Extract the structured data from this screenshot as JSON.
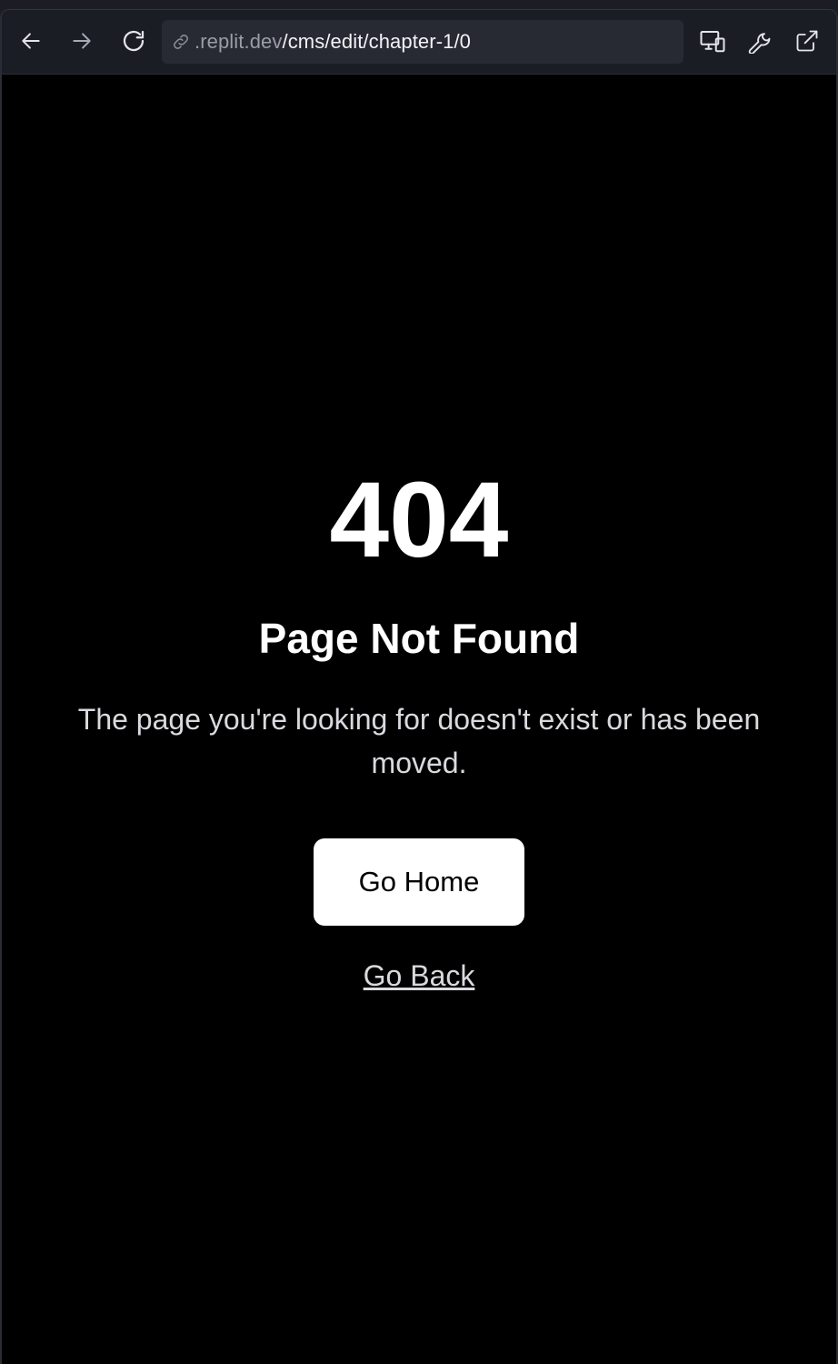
{
  "browser": {
    "url_host": ".replit.dev",
    "url_path": "/cms/edit/chapter-1/0",
    "icons": {
      "back": "arrow-left-icon",
      "forward": "arrow-right-icon",
      "reload": "reload-icon",
      "link": "link-icon",
      "devices": "devices-icon",
      "devtools": "wrench-icon",
      "open_external": "external-link-icon"
    }
  },
  "page": {
    "error_code": "404",
    "title": "Page Not Found",
    "description": "The page you're looking for doesn't exist or has been moved.",
    "home_button_label": "Go Home",
    "back_link_label": "Go Back"
  },
  "colors": {
    "page_background": "#000000",
    "toolbar_background": "#1b1d25",
    "button_background": "#ffffff"
  }
}
